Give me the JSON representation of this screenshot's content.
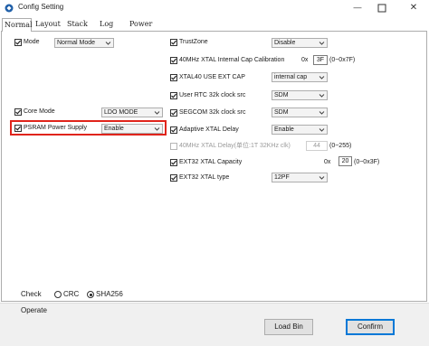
{
  "window": {
    "title": "Config Setting",
    "minimize_glyph": "—",
    "close_glyph": "✕"
  },
  "tabs": [
    {
      "label": "Normal",
      "active": true
    },
    {
      "label": "Layout",
      "active": false
    },
    {
      "label": "Stack",
      "active": false
    },
    {
      "label": "Log",
      "active": false
    },
    {
      "label": "Power",
      "active": false
    }
  ],
  "left": {
    "mode": {
      "label": "Mode",
      "checked": true,
      "value": "Normal Mode"
    },
    "core_mode": {
      "label": "Core Mode",
      "checked": true,
      "value": "LDO MODE"
    },
    "psram": {
      "label": "PSRAM Power Supply",
      "checked": true,
      "value": "Enable"
    }
  },
  "right": {
    "trustzone": {
      "label": "TrustZone",
      "checked": true,
      "value": "Disable"
    },
    "xtal_cap_cal": {
      "label": "40MHz XTAL Internal Cap Calibration",
      "checked": true,
      "prefix": "0x",
      "value": "3F",
      "range": "(0~0x7F)"
    },
    "xtal40_ext_cap": {
      "label": "XTAL40 USE EXT CAP",
      "checked": true,
      "value": "internal cap"
    },
    "rtc_32k": {
      "label": "User RTC 32k clock src",
      "checked": true,
      "value": "SDM"
    },
    "segcom_32k": {
      "label": "SEGCOM 32k clock src",
      "checked": true,
      "value": "SDM"
    },
    "adaptive_xtal": {
      "label": "Adaptive XTAL Delay",
      "checked": true,
      "value": "Enable"
    },
    "xtal_delay": {
      "label": "40MHz XTAL Delay(单位:1T 32KHz clk)",
      "checked": false,
      "value": "44",
      "range": "(0~255)"
    },
    "ext32_cap": {
      "label": "EXT32 XTAL Capacity",
      "checked": true,
      "prefix": "0x",
      "value": "20",
      "range": "(0~0x3F)"
    },
    "ext32_type": {
      "label": "EXT32 XTAL type",
      "checked": true,
      "value": "12PF"
    }
  },
  "check": {
    "label": "Check",
    "options": [
      {
        "label": "CRC",
        "selected": false
      },
      {
        "label": "SHA256",
        "selected": true
      }
    ]
  },
  "operate": {
    "label": "Operate",
    "load_bin_label": "Load Bin",
    "confirm_label": "Confirm"
  },
  "colors": {
    "highlight": "#e0241b",
    "focus_border": "#0078d7",
    "panel_border": "#adadad"
  }
}
